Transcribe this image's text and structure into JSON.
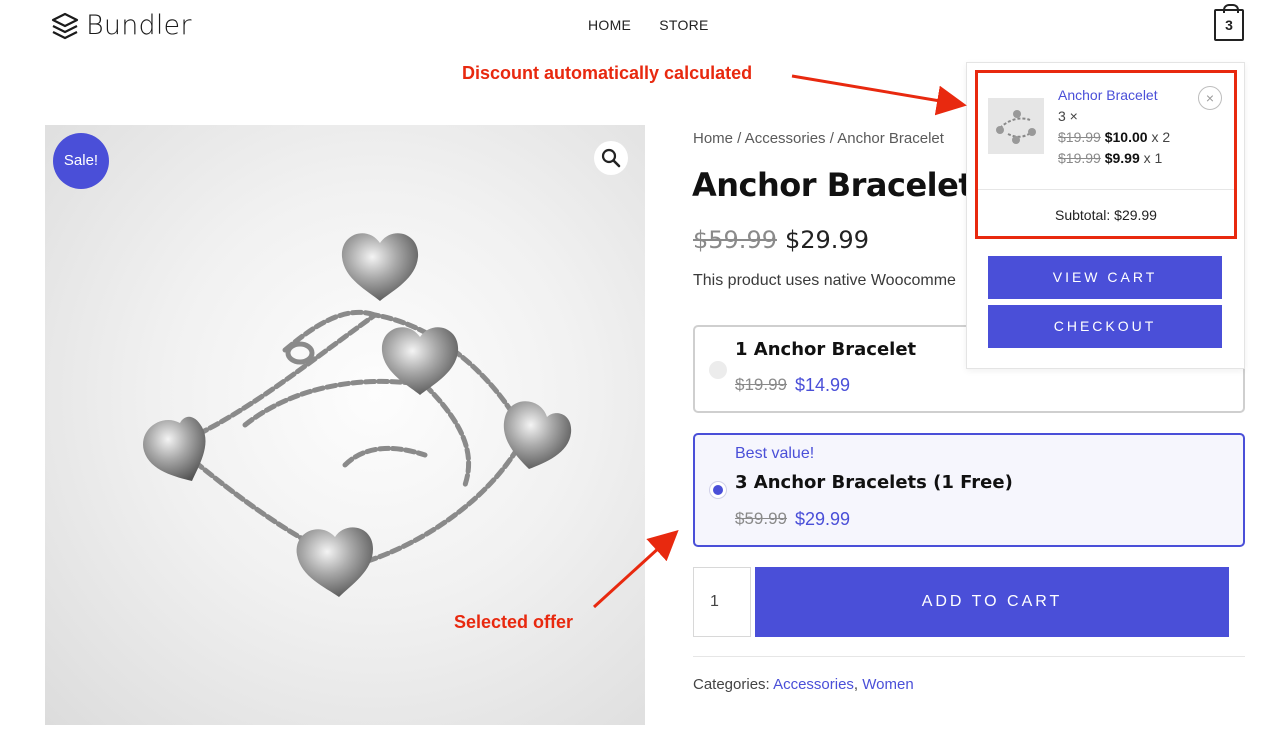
{
  "header": {
    "logo_text": "Bundler",
    "nav": [
      "HOME",
      "STORE"
    ],
    "cart_count": "3"
  },
  "annotations": {
    "discount": "Discount automatically calculated",
    "selected": "Selected offer"
  },
  "product": {
    "sale_badge": "Sale!",
    "breadcrumb": "Home / Accessories / Anchor Bracelet",
    "title": "Anchor Bracelet",
    "price_old": "$59.99",
    "price_new": "$29.99",
    "description": "This product uses native Woocomme",
    "offers": [
      {
        "badge": "",
        "title": "1 Anchor Bracelet",
        "price_old": "$19.99",
        "price_new": "$14.99",
        "selected": false
      },
      {
        "badge": "Best value!",
        "title": "3 Anchor Bracelets (1 Free)",
        "price_old": "$59.99",
        "price_new": "$29.99",
        "selected": true
      }
    ],
    "quantity": "1",
    "add_to_cart": "ADD TO CART",
    "categories_label": "Categories:",
    "categories": [
      "Accessories",
      "Women"
    ]
  },
  "minicart": {
    "item_name": "Anchor Bracelet",
    "item_qty": "3 ×",
    "lines": [
      {
        "old": "$19.99",
        "new": "$10.00",
        "mult": "x 2"
      },
      {
        "old": "$19.99",
        "new": "$9.99",
        "mult": "x 1"
      }
    ],
    "remove": "×",
    "subtotal": "Subtotal: $29.99",
    "view_cart": "VIEW CART",
    "checkout": "CHECKOUT"
  },
  "colors": {
    "accent": "#4a4fd8",
    "annotation": "#e8290f"
  }
}
